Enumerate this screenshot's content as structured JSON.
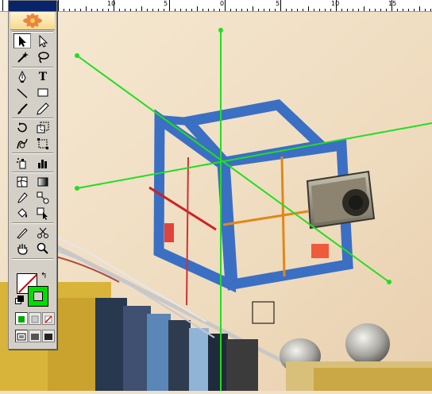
{
  "ruler": {
    "labels": [
      "10",
      "5",
      "0",
      "5",
      "10",
      "15"
    ]
  },
  "toolbox": {
    "tools": [
      {
        "name": "selection-tool-icon"
      },
      {
        "name": "direct-selection-tool-icon"
      },
      {
        "name": "magic-wand-tool-icon"
      },
      {
        "name": "lasso-tool-icon"
      },
      {
        "name": "pen-tool-icon"
      },
      {
        "name": "type-tool-icon",
        "glyph": "T"
      },
      {
        "name": "line-segment-tool-icon"
      },
      {
        "name": "rectangle-tool-icon"
      },
      {
        "name": "paintbrush-tool-icon"
      },
      {
        "name": "pencil-tool-icon"
      },
      {
        "name": "rotate-tool-icon"
      },
      {
        "name": "scale-tool-icon"
      },
      {
        "name": "warp-tool-icon"
      },
      {
        "name": "free-transform-tool-icon"
      },
      {
        "name": "symbol-sprayer-tool-icon"
      },
      {
        "name": "column-graph-tool-icon"
      },
      {
        "name": "mesh-tool-icon"
      },
      {
        "name": "gradient-tool-icon"
      },
      {
        "name": "eyedropper-tool-icon"
      },
      {
        "name": "blend-tool-icon"
      },
      {
        "name": "live-paint-bucket-tool-icon"
      },
      {
        "name": "live-paint-selection-tool-icon"
      },
      {
        "name": "slice-tool-icon"
      },
      {
        "name": "scissors-tool-icon"
      },
      {
        "name": "hand-tool-icon"
      },
      {
        "name": "zoom-tool-icon"
      }
    ],
    "fill_color": "#ffffff",
    "stroke_color": "#00dd00"
  },
  "colors": {
    "guide_green": "#22dd22",
    "tape_blue": "#3a6fc4",
    "wall": "#efe0c8",
    "red_line": "#cc2222",
    "orange_line": "#e0881a"
  }
}
